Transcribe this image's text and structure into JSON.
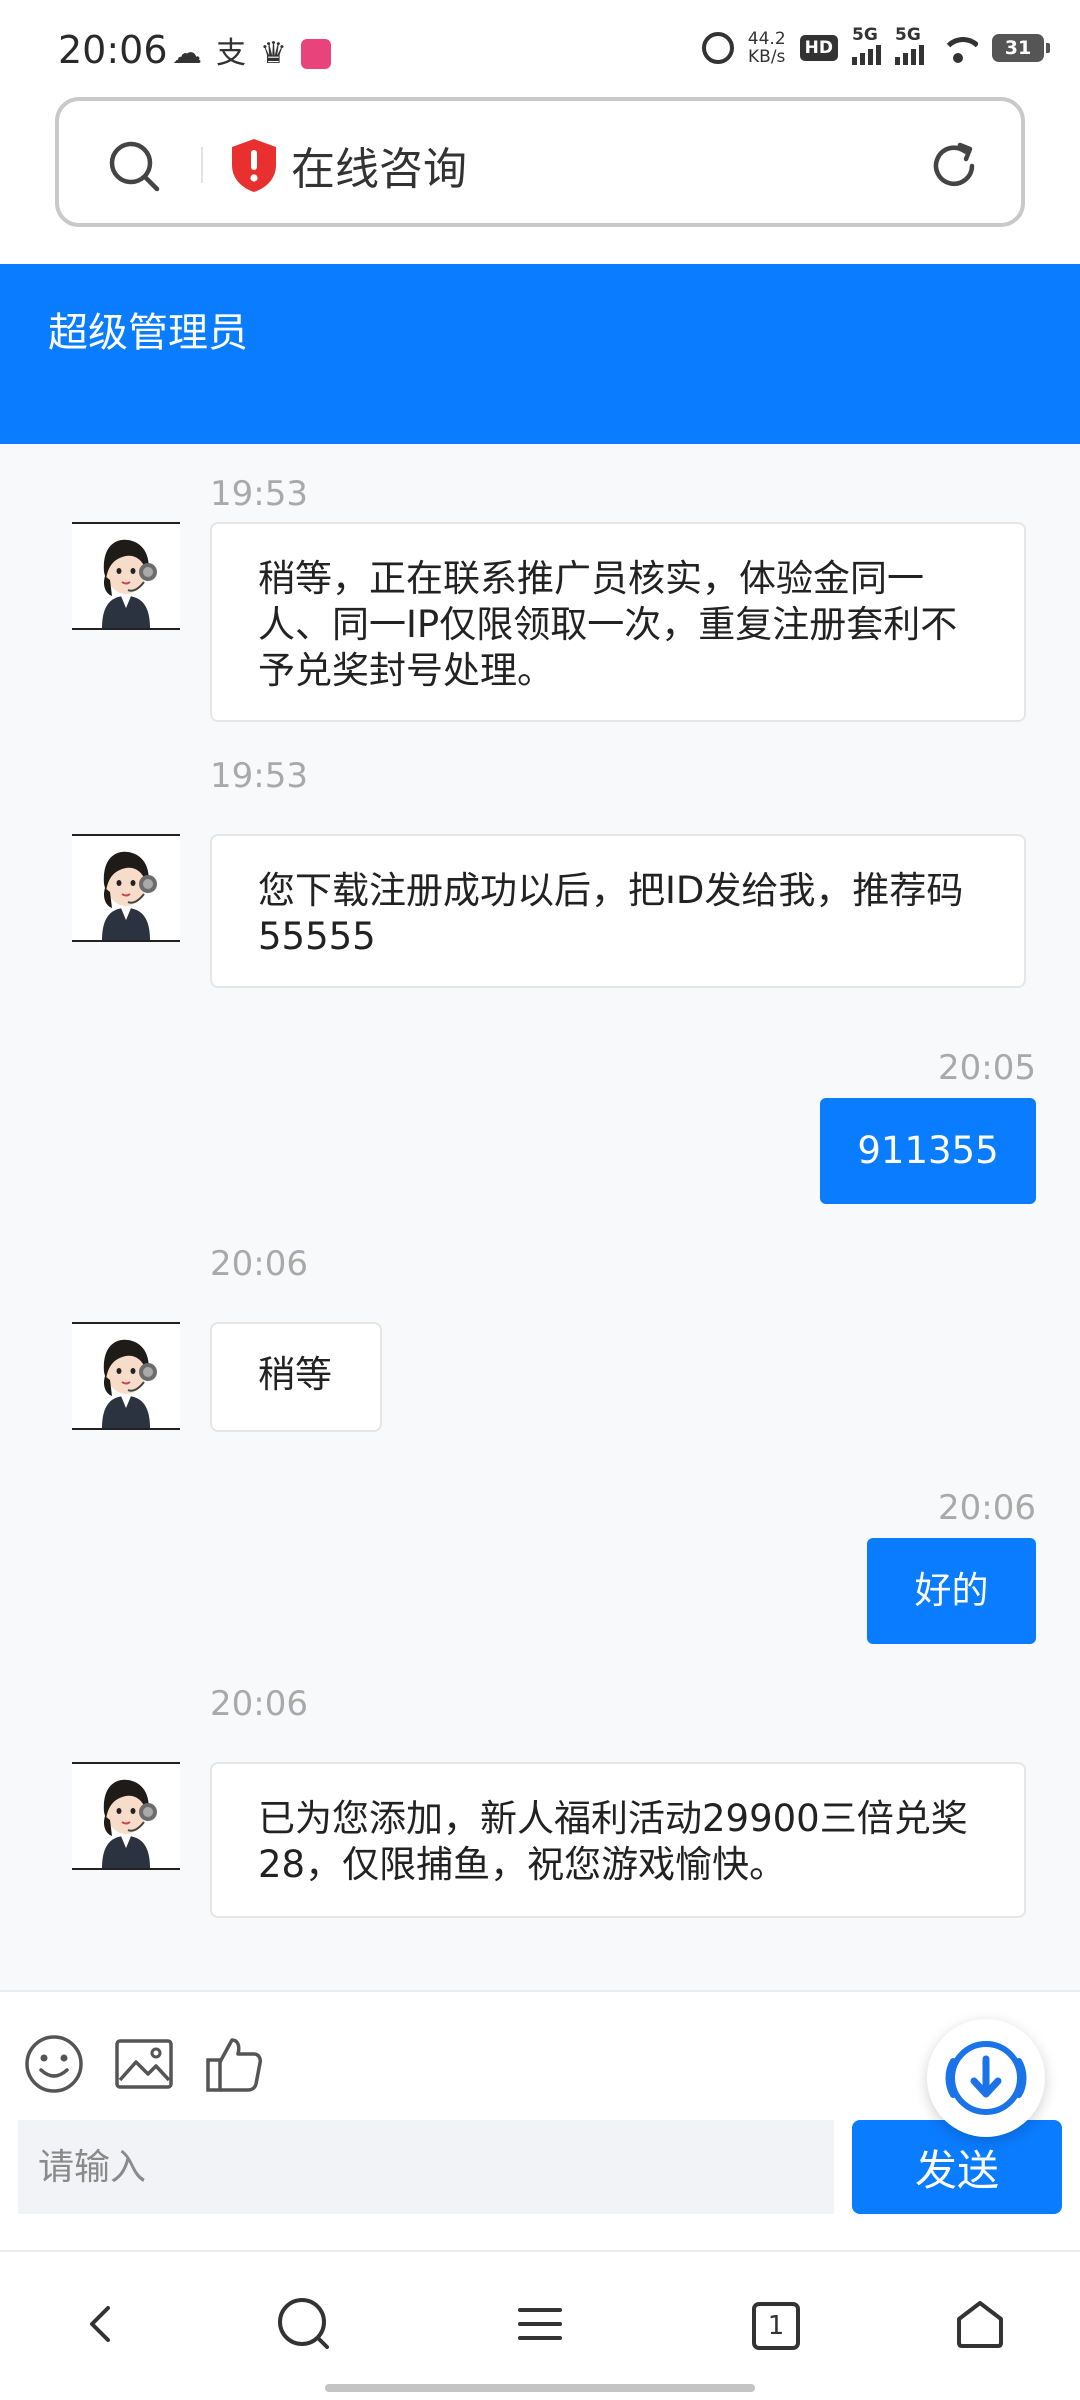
{
  "status_bar": {
    "time": "20:06",
    "net_speed_value": "44.2",
    "net_speed_unit": "KB/s",
    "hd_label": "HD",
    "signal_1_label": "5G",
    "signal_2_label": "5G",
    "battery": "31"
  },
  "browser": {
    "page_title": "在线咨询",
    "icons": [
      "search-icon",
      "shield-icon",
      "reload-icon"
    ]
  },
  "header": {
    "agent_name": "超级管理员",
    "accent_color": "#0a7cff"
  },
  "messages": [
    {
      "direction": "in",
      "time": "19:53",
      "text": "稍等，正在联系推广员核实，体验金同一人、同一IP仅限领取一次，重复注册套利不予兑奖封号处理。"
    },
    {
      "direction": "in",
      "time": "19:53",
      "text": "您下载注册成功以后，把ID发给我，推荐码55555"
    },
    {
      "direction": "out",
      "time": "20:05",
      "text": "911355"
    },
    {
      "direction": "in",
      "time": "20:06",
      "text": "稍等"
    },
    {
      "direction": "out",
      "time": "20:06",
      "text": "好的"
    },
    {
      "direction": "in",
      "time": "20:06",
      "text": "已为您添加，新人福利活动29900三倍兑奖28，仅限捕鱼，祝您游戏愉快。"
    }
  ],
  "composer": {
    "toolbar_icons": [
      "emoji-icon",
      "image-icon",
      "thumbs-up-icon"
    ],
    "input_value": "",
    "input_placeholder": "请输入",
    "send_label": "发送"
  },
  "bottom_nav": {
    "tab_count": "1",
    "items": [
      "back-icon",
      "search-icon",
      "menu-icon",
      "tabs-icon",
      "home-icon"
    ]
  }
}
